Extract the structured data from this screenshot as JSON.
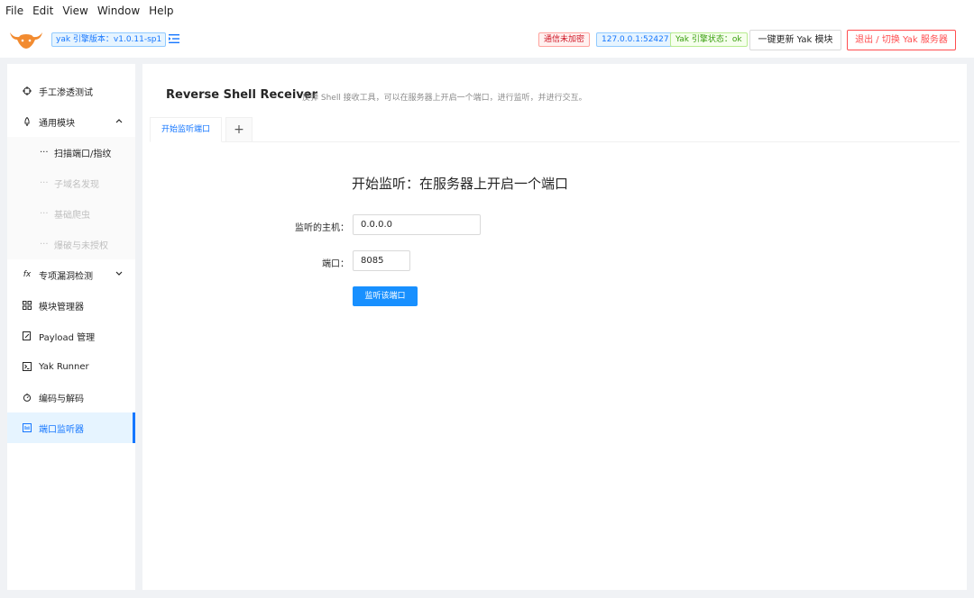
{
  "menubar": {
    "items": [
      "File",
      "Edit",
      "View",
      "Window",
      "Help"
    ]
  },
  "header": {
    "version": "yak 引擎版本：v1.0.11-sp1",
    "tag_encryption": "通信未加密",
    "tag_address": "127.0.0.1:52427",
    "tag_status": "Yak 引擎状态：ok",
    "update_button": "一键更新 Yak 模块",
    "exit_button": "退出 / 切换 Yak 服务器"
  },
  "sidebar": {
    "items": [
      {
        "label": "手工渗透测试",
        "icon": "crosshair-icon"
      },
      {
        "label": "通用模块",
        "icon": "rocket-icon"
      },
      {
        "label": "扫描端口/指纹"
      },
      {
        "label": "子域名发现"
      },
      {
        "label": "基础爬虫"
      },
      {
        "label": "爆破与未授权"
      },
      {
        "label": "专项漏洞检测",
        "icon": "function-icon"
      },
      {
        "label": "模块管理器",
        "icon": "grid-icon"
      },
      {
        "label": "Payload 管理",
        "icon": "file-edit-icon"
      },
      {
        "label": "Yak Runner",
        "icon": "terminal-icon"
      },
      {
        "label": "编码与解码",
        "icon": "timer-icon"
      },
      {
        "label": "端口监听器",
        "icon": "monitor-icon"
      }
    ],
    "dots": "···"
  },
  "main": {
    "title": "Reverse Shell Receiver",
    "description": "反弹 Shell 接收工具，可以在服务器上开启一个端口，进行监听，并进行交互。",
    "tabs": [
      {
        "label": "开始监听端口"
      },
      {
        "label": "+"
      }
    ],
    "form": {
      "title": "开始监听：在服务器上开启一个端口",
      "host_label": "监听的主机：",
      "host_value": "0.0.0.0",
      "port_label": "端口：",
      "port_value": "8085",
      "submit_label": "监听该端口"
    }
  },
  "colors": {
    "primary": "#1890ff",
    "danger": "#ff4d4f",
    "brand": "#f28b30"
  }
}
